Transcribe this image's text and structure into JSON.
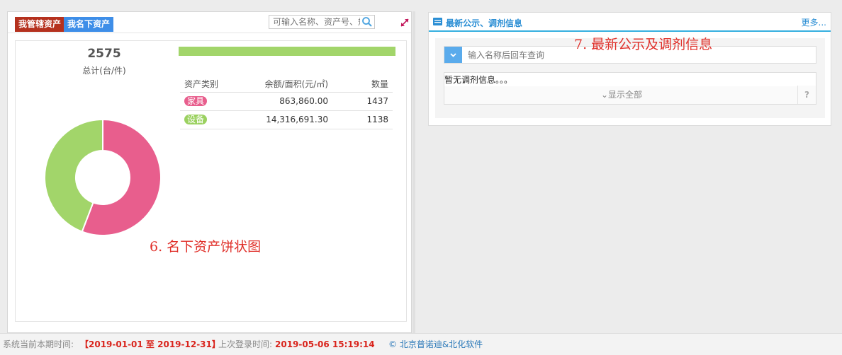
{
  "left_panel": {
    "tabs": [
      {
        "label": "我管辖资产"
      },
      {
        "label": "我名下资产"
      }
    ],
    "search": {
      "placeholder": "可输入名称、资产号、规格"
    },
    "summary": {
      "total": "2575",
      "total_label": "总计(台/件)"
    },
    "table": {
      "headers": [
        "资产类别",
        "余额/面积(元/㎡)",
        "数量"
      ],
      "rows": [
        {
          "category": "家具",
          "amount": "863,860.00",
          "count": "1437"
        },
        {
          "category": "设备",
          "amount": "14,316,691.30",
          "count": "1138"
        }
      ]
    },
    "annotation": "6. 名下资产饼状图"
  },
  "chart_data": {
    "type": "pie",
    "categories": [
      "家具",
      "设备"
    ],
    "values": [
      1437,
      1138
    ],
    "colors": [
      "#e85e8d",
      "#a2d56a"
    ]
  },
  "right_panel": {
    "title": "最新公示、调剂信息",
    "more_label": "更多...",
    "search_placeholder": "输入名称后回车查询",
    "empty_message": "暂无调剂信息。。。",
    "show_all_label": "⌄显示全部",
    "help_label": "?",
    "annotation": "7. 最新公示及调剂信息"
  },
  "footer": {
    "period_label": "系统当前本期时间:",
    "period_value": "【2019-01-01 至 2019-12-31】",
    "login_label": "上次登录时间:",
    "login_value": "2019-05-06 15:19:14",
    "copyright": "© 北京普诺迪&北化软件"
  },
  "colors": {
    "tab_managed": "#b5311e",
    "tab_mine": "#3e8ee8",
    "accent_blue": "#36b0e0",
    "annotation_red": "#e0302a"
  }
}
